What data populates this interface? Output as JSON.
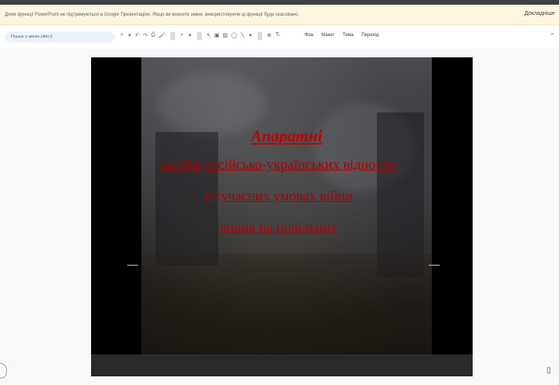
{
  "banner": {
    "message": "Деякі функції PowerPoint не підтримуються в Google Презентаціях. Якщо ви внесете зміни, використовуючи ці функції буде скасовано.",
    "action_label": "Докладніше"
  },
  "toolbar": {
    "menu_search_placeholder": "Пошук у меню (Alt+/)",
    "menus": [
      "Фон",
      "Макет",
      "Тема",
      "Перехід"
    ]
  },
  "slide": {
    "title": "Апаратні",
    "lines": [
      "засоби російсько-українських відносин",
      "в сучасних умовах війни",
      "вплив на цивільних"
    ],
    "colors": {
      "text": "#c00000",
      "background": "#000000"
    }
  }
}
